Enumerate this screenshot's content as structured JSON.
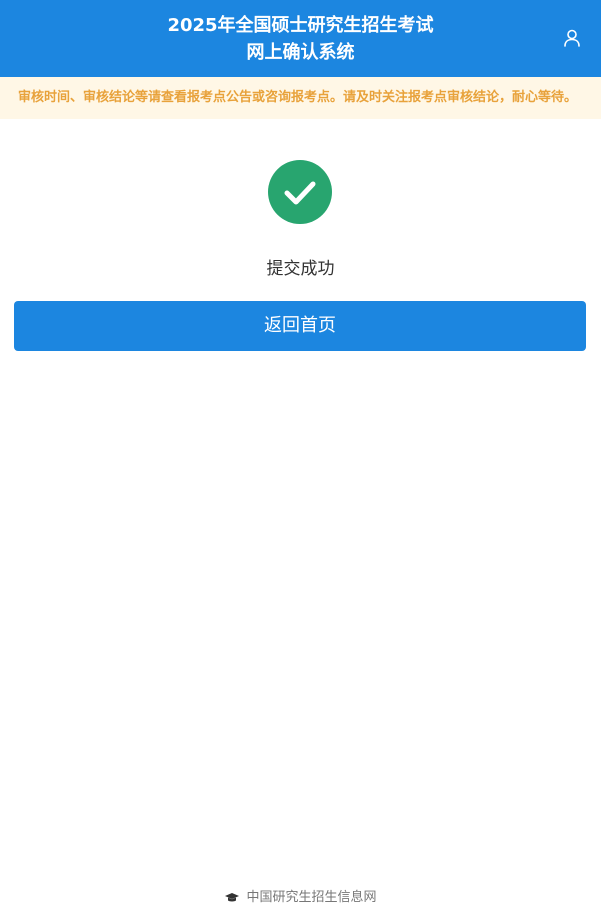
{
  "header": {
    "title_line1": "2025年全国硕士研究生招生考试",
    "title_line2": "网上确认系统",
    "user_icon": "user-icon"
  },
  "notice": {
    "text": "审核时间、审核结论等请查看报考点公告或咨询报考点。请及时关注报考点审核结论，耐心等待。"
  },
  "result": {
    "icon": "check-circle-icon",
    "message": "提交成功"
  },
  "actions": {
    "back_home_label": "返回首页"
  },
  "footer": {
    "icon": "graduation-cap-icon",
    "text": "中国研究生招生信息网"
  },
  "colors": {
    "primary": "#1c86e0",
    "success": "#28a56f",
    "notice_bg": "#fff7e6",
    "notice_text": "#e8a23b"
  }
}
